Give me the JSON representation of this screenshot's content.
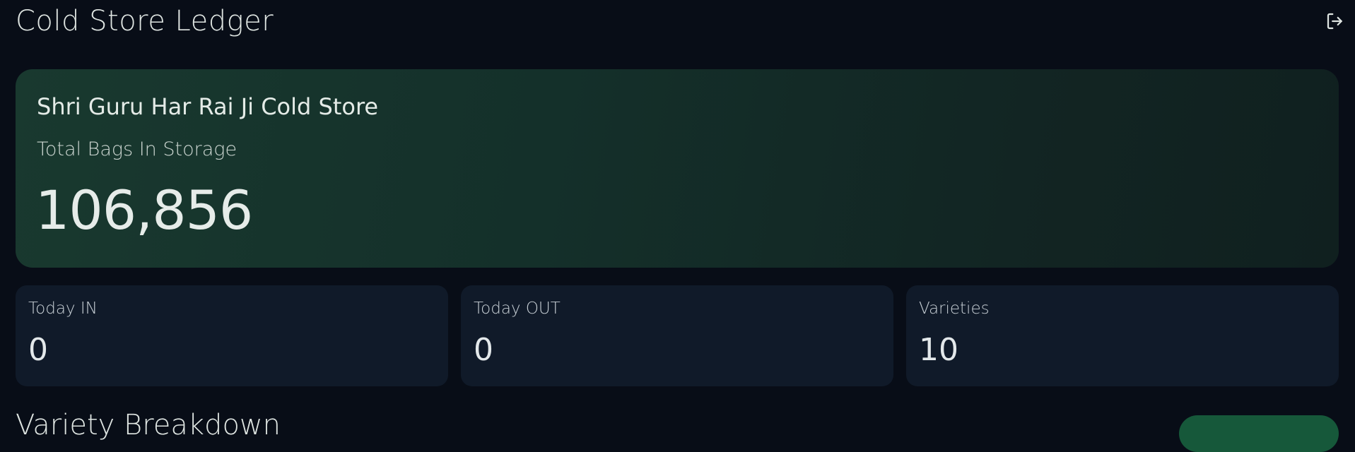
{
  "header": {
    "title": "Cold Store Ledger",
    "logout_icon": "logout-icon"
  },
  "hero": {
    "store_name": "Shri Guru Har Rai Ji Cold Store",
    "label": "Total Bags In Storage",
    "value": "106,856"
  },
  "stats": [
    {
      "label": "Today IN",
      "value": "0"
    },
    {
      "label": "Today OUT",
      "value": "0"
    },
    {
      "label": "Varieties",
      "value": "10"
    }
  ],
  "section": {
    "title": "Variety Breakdown"
  },
  "colors": {
    "background": "#080d17",
    "hero_card": "#17362d",
    "stat_card": "#101a29",
    "accent_green": "#16583a",
    "text": "#e6ebe8"
  }
}
